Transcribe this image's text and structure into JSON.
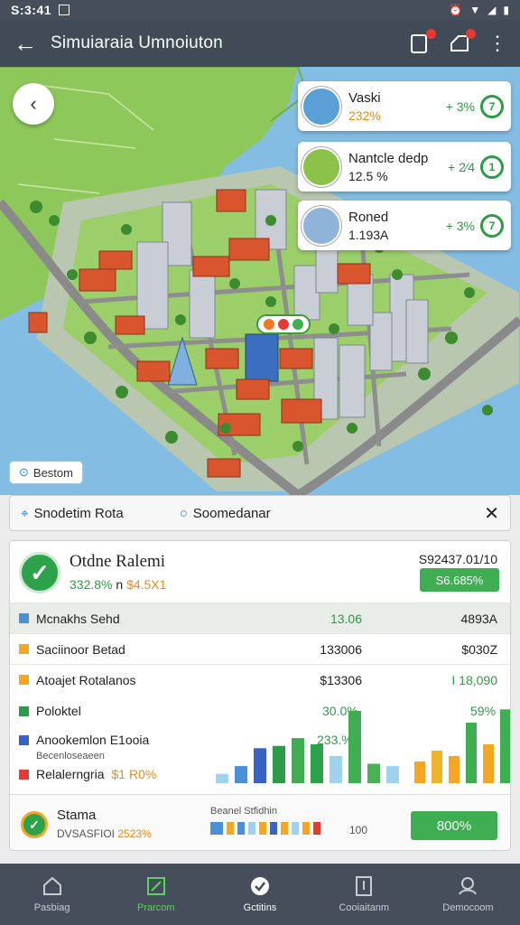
{
  "status_bar": {
    "time": "S:3:41"
  },
  "app_bar": {
    "title": "Simuiaraia Umnoiuton"
  },
  "map_cards": [
    {
      "name": "Vaski",
      "pct": "232%",
      "delta": "+ 3%",
      "pct_color": "#e78b19"
    },
    {
      "name": "Nantcle dedp",
      "pct": "12.5 %",
      "delta": "+ 2⁄4",
      "pct_color": "#444444"
    },
    {
      "name": "Roned",
      "pct": "1.193A",
      "delta": "+ 3%",
      "pct_color": "#444444"
    }
  ],
  "map_chip": {
    "label": "Bestom"
  },
  "search": {
    "left": "Snodetim Rota",
    "right": "Soomedanar"
  },
  "panel": {
    "title": "Otdne Ralemi",
    "sub_green": "332.8%",
    "sub_mid": "n",
    "sub_orange": "$4.5X1",
    "total": "S92437.01/10",
    "button": "S6.685%",
    "rows": [
      {
        "label": "Mcnakhs Sehd",
        "v1": "13.06",
        "v2": "4893A",
        "color": "#4a90d9",
        "v1_color": "#2e9b48"
      },
      {
        "label": "Saciinoor Betad",
        "v1": "133006",
        "v2": "$030Z",
        "color": "#f5a623",
        "v1_color": "#222222"
      },
      {
        "label": "Atoajet Rotalanos",
        "v1": "$13306",
        "v2": "I 18,090",
        "color": "#f5a623",
        "v1_color": "#222222",
        "v2_color": "#2e9b48"
      }
    ],
    "chart_labels": [
      {
        "label": "Poloktel",
        "color": "#2e9b48",
        "value": "30.0%"
      },
      {
        "label": "Anookemlon E1ooia",
        "color": "#3a62c4",
        "value": "233.%"
      },
      {
        "label": "Relalerngria",
        "color": "#e53935",
        "value": "$1 R0%"
      }
    ],
    "chart_sub": "Becenloseaeen",
    "right_value": "59%",
    "footer": {
      "title": "Stama",
      "sub": "DVSASFIOI",
      "sub_pct": "2523%",
      "bar_label": "Beanel Stfidhin",
      "bar_num": "100",
      "button": "800%"
    }
  },
  "chart_data": {
    "type": "bar",
    "series": [
      {
        "values": [
          0.12,
          0.22,
          0.45,
          0.48,
          0.58,
          0.5,
          0.35,
          0.93,
          0.25,
          0.22
        ]
      },
      {
        "values": [
          0.28,
          0.42,
          0.35,
          0.78,
          0.5,
          0.95,
          0.7
        ]
      }
    ],
    "colors": [
      "#9fd2ef",
      "#4a90d9",
      "#3a62c4",
      "#2e9b48",
      "#3fae52",
      "#2ea24b",
      "#9fd2ef",
      "#3fae52",
      "#4cb154",
      "#9fd2ef"
    ],
    "colors_right": [
      "#f5a623",
      "#f0b429",
      "#f5a623",
      "#3fae52",
      "#f5a623",
      "#3fae52",
      "#2ea24b"
    ]
  },
  "nav": [
    {
      "label": "Pasbiag"
    },
    {
      "label": "Prarcom"
    },
    {
      "label": "Gctitins"
    },
    {
      "label": "Cooiaitanm"
    },
    {
      "label": "Democoom"
    }
  ]
}
